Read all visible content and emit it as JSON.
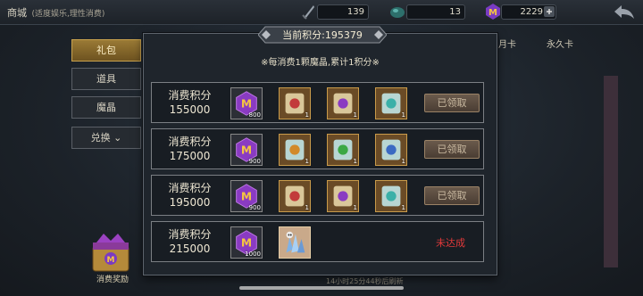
{
  "topbar": {
    "title": "商城",
    "subtitle": "(适度娱乐,理性消费)",
    "resources": [
      {
        "name": "stamina",
        "icon": "sword-icon",
        "value": "139"
      },
      {
        "name": "energy",
        "icon": "stone-icon",
        "value": "13"
      },
      {
        "name": "gems",
        "icon": "magic-crystal-icon",
        "value": "2229"
      }
    ]
  },
  "sidebar": {
    "items": [
      {
        "label": "礼包",
        "active": true
      },
      {
        "label": "道具",
        "active": false
      },
      {
        "label": "魔晶",
        "active": false
      },
      {
        "label": "兑换 ⌄",
        "active": false
      }
    ],
    "bonus_label": "消费奖励"
  },
  "right_tabs": [
    "全月卡",
    "永久卡"
  ],
  "refresh_text": "14小时25分44秒后刷新",
  "popup": {
    "current_points": "当前积分:195379",
    "rule": "※每消费1颗魔晶,累计1积分※",
    "rows": [
      {
        "label_line1": "消费积分",
        "label_line2": "155000",
        "crystal_count": "800",
        "scrolls": [
          {
            "color": "#c23b3b",
            "count": "1"
          },
          {
            "color": "#8a3bc2",
            "count": "1"
          },
          {
            "color": "#3bb0a8",
            "count": "1"
          }
        ],
        "status": "已领取",
        "claimed": true
      },
      {
        "label_line1": "消费积分",
        "label_line2": "175000",
        "crystal_count": "900",
        "scrolls": [
          {
            "color": "#d28a2a",
            "count": "1"
          },
          {
            "color": "#3ba844",
            "count": "1"
          },
          {
            "color": "#3b6ac2",
            "count": "1"
          }
        ],
        "status": "已领取",
        "claimed": true
      },
      {
        "label_line1": "消费积分",
        "label_line2": "195000",
        "crystal_count": "900",
        "scrolls": [
          {
            "color": "#c23b3b",
            "count": "1"
          },
          {
            "color": "#8a3bc2",
            "count": "1"
          },
          {
            "color": "#3bb0a8",
            "count": "1"
          }
        ],
        "status": "已领取",
        "claimed": true
      },
      {
        "label_line1": "消费积分",
        "label_line2": "215000",
        "crystal_count": "1000",
        "special_item": "ice-crystal-skull-icon",
        "status": "未达成",
        "claimed": false
      }
    ]
  }
}
